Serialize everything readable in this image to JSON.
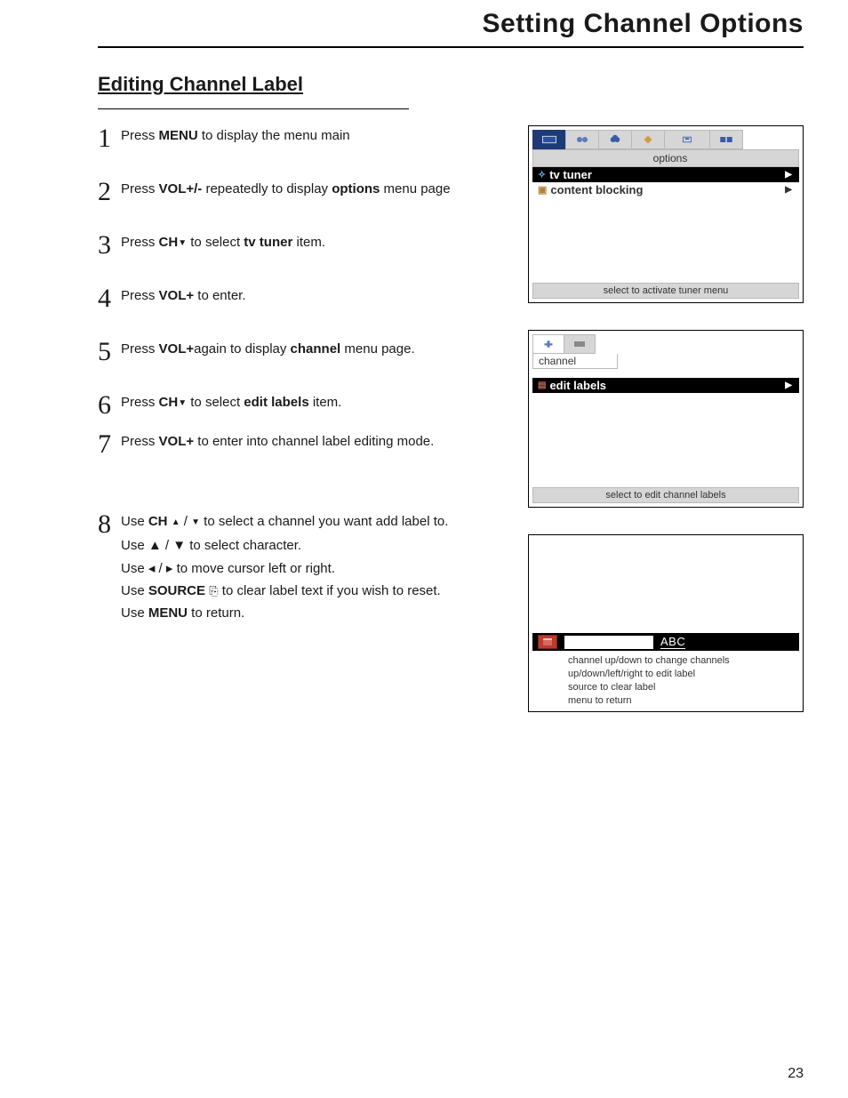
{
  "page": {
    "title": "Setting Channel Options",
    "section_title": "Editing Channel Label",
    "number": "23"
  },
  "steps": {
    "s1": {
      "num": "1",
      "pre": "Press  ",
      "kw": "MENU",
      "post": " to display the menu main"
    },
    "s2": {
      "num": "2",
      "pre": "Press ",
      "kw": "VOL+/-",
      "mid": " repeatedly to display ",
      "kw2": "options",
      "post": " menu page"
    },
    "s3": {
      "num": "3",
      "pre": "Press ",
      "kw": "CH",
      "mid": "  to select ",
      "kw2": "tv tuner",
      "post": " item."
    },
    "s4": {
      "num": "4",
      "pre": "Press ",
      "kw": "VOL+",
      "post": " to enter."
    },
    "s5": {
      "num": "5",
      "pre": "Press ",
      "kw": "VOL+",
      "mid": "again to display ",
      "kw2": "channel",
      "post": " menu page."
    },
    "s6": {
      "num": "6",
      "pre": "Press ",
      "kw": "CH",
      "mid": " to select ",
      "kw2": "edit labels",
      "post": " item."
    },
    "s7": {
      "num": "7",
      "pre": "Press ",
      "kw": "VOL+",
      "post": " to enter into channel label editing mode."
    },
    "s8": {
      "num": "8",
      "line1_pre": "Use ",
      "line1_kw": "CH",
      "line1_post": "  to select a channel you want add label to.",
      "line2": "Use  ▲ / ▼  to select character.",
      "line3": "Use  ◂ / ▸  to move cursor left or right.",
      "line4_pre": "Use ",
      "line4_kw": "SOURCE",
      "line4_post": "  to clear label text if you wish to reset.",
      "line5_pre": "Use ",
      "line5_kw": "MENU",
      "line5_post": " to return."
    }
  },
  "panel1": {
    "caption": "options",
    "item1": "tv tuner",
    "item2": "content blocking",
    "status": "select to activate tuner menu"
  },
  "panel2": {
    "caption": "channel",
    "item1": "edit labels",
    "status": "select to edit channel labels"
  },
  "panel3": {
    "abc": "ABC",
    "help1": "channel up/down to change channels",
    "help2": "up/down/left/right to edit label",
    "help3": "source to clear label",
    "help4": "menu to return"
  }
}
